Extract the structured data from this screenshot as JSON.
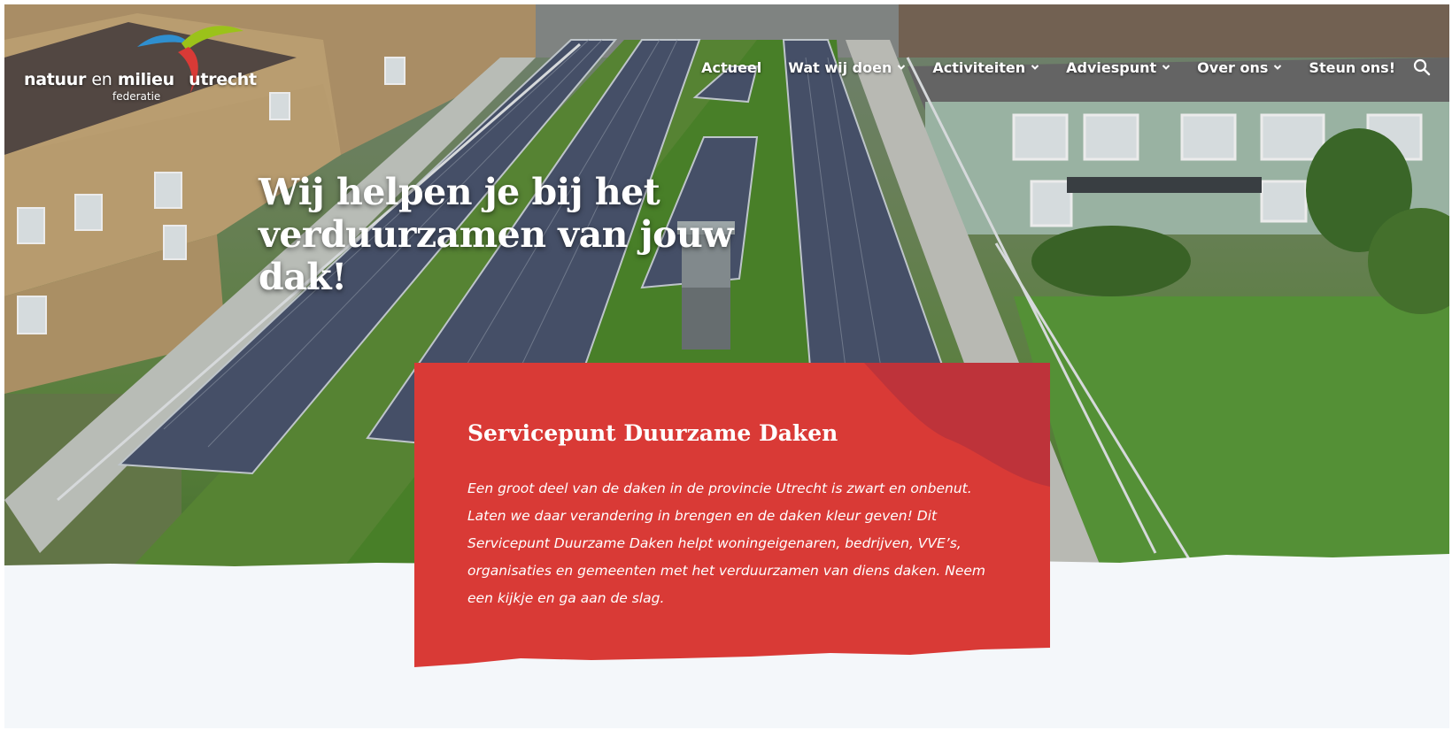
{
  "brand": {
    "logo_part1": "natuur",
    "logo_part2": "en",
    "logo_part3": "milieu",
    "logo_part4": "utrecht",
    "logo_sub": "federatie",
    "colors": {
      "red": "#d93a36",
      "green": "#9bc21a",
      "blue": "#2f8fcf",
      "paper": "#f4f7fa"
    }
  },
  "nav": {
    "items": [
      {
        "label": "Actueel",
        "has_dropdown": false
      },
      {
        "label": "Wat wij doen",
        "has_dropdown": true
      },
      {
        "label": "Activiteiten",
        "has_dropdown": true
      },
      {
        "label": "Adviespunt",
        "has_dropdown": true
      },
      {
        "label": "Over ons",
        "has_dropdown": true
      },
      {
        "label": "Steun ons!",
        "has_dropdown": false
      }
    ],
    "search_icon": "search-icon"
  },
  "hero": {
    "title": "Wij helpen je bij het verduurzamen van jouw dak!"
  },
  "card": {
    "title": "Servicepunt Duurzame Daken",
    "text": "Een groot deel van de daken in de provincie Utrecht is zwart en onbenut. Laten we daar verandering in brengen en de daken kleur geven! Dit Servicepunt Duurzame Daken helpt woningeigenaren, bedrijven, VVE’s, organisaties en gemeenten met het verduurzamen van diens daken. Neem een kijkje en ga aan de slag."
  }
}
